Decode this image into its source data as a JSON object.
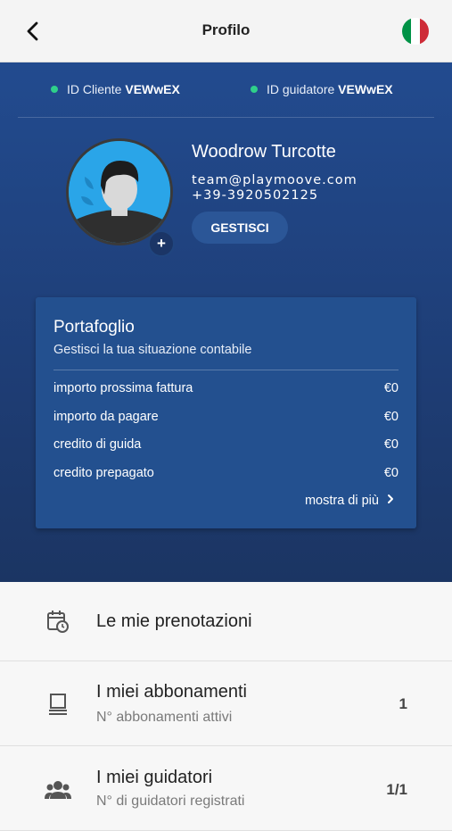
{
  "header": {
    "title": "Profilo"
  },
  "colors": {
    "accent": "#224b8f",
    "status_dot": "#2fd08a",
    "flag": [
      "#009246",
      "#ffffff",
      "#ce2b37"
    ]
  },
  "ids": {
    "client_label": "ID Cliente",
    "client_value": "VEWwEX",
    "driver_label": "ID guidatore",
    "driver_value": "VEWwEX"
  },
  "profile": {
    "name": "Woodrow Turcotte",
    "email": "team@playmoove.com",
    "phone": "+39-3920502125",
    "manage_label": "GESTISCI",
    "avatar_add": "+"
  },
  "wallet": {
    "title": "Portafoglio",
    "subtitle": "Gestisci la tua situazione contabile",
    "rows": [
      {
        "label": "importo prossima fattura",
        "value": "€0"
      },
      {
        "label": "importo da pagare",
        "value": "€0"
      },
      {
        "label": "credito di guida",
        "value": "€0"
      },
      {
        "label": "credito prepagato",
        "value": "€0"
      }
    ],
    "more_label": "mostra di più"
  },
  "menu": [
    {
      "label": "Le mie prenotazioni",
      "icon": "calendar-clock-icon"
    },
    {
      "label": "I miei abbonamenti",
      "sub": "N° abbonamenti attivi",
      "count": "1",
      "icon": "subscription-icon"
    },
    {
      "label": "I miei guidatori",
      "sub": "N° di guidatori registrati",
      "count": "1/1",
      "icon": "group-icon"
    }
  ]
}
